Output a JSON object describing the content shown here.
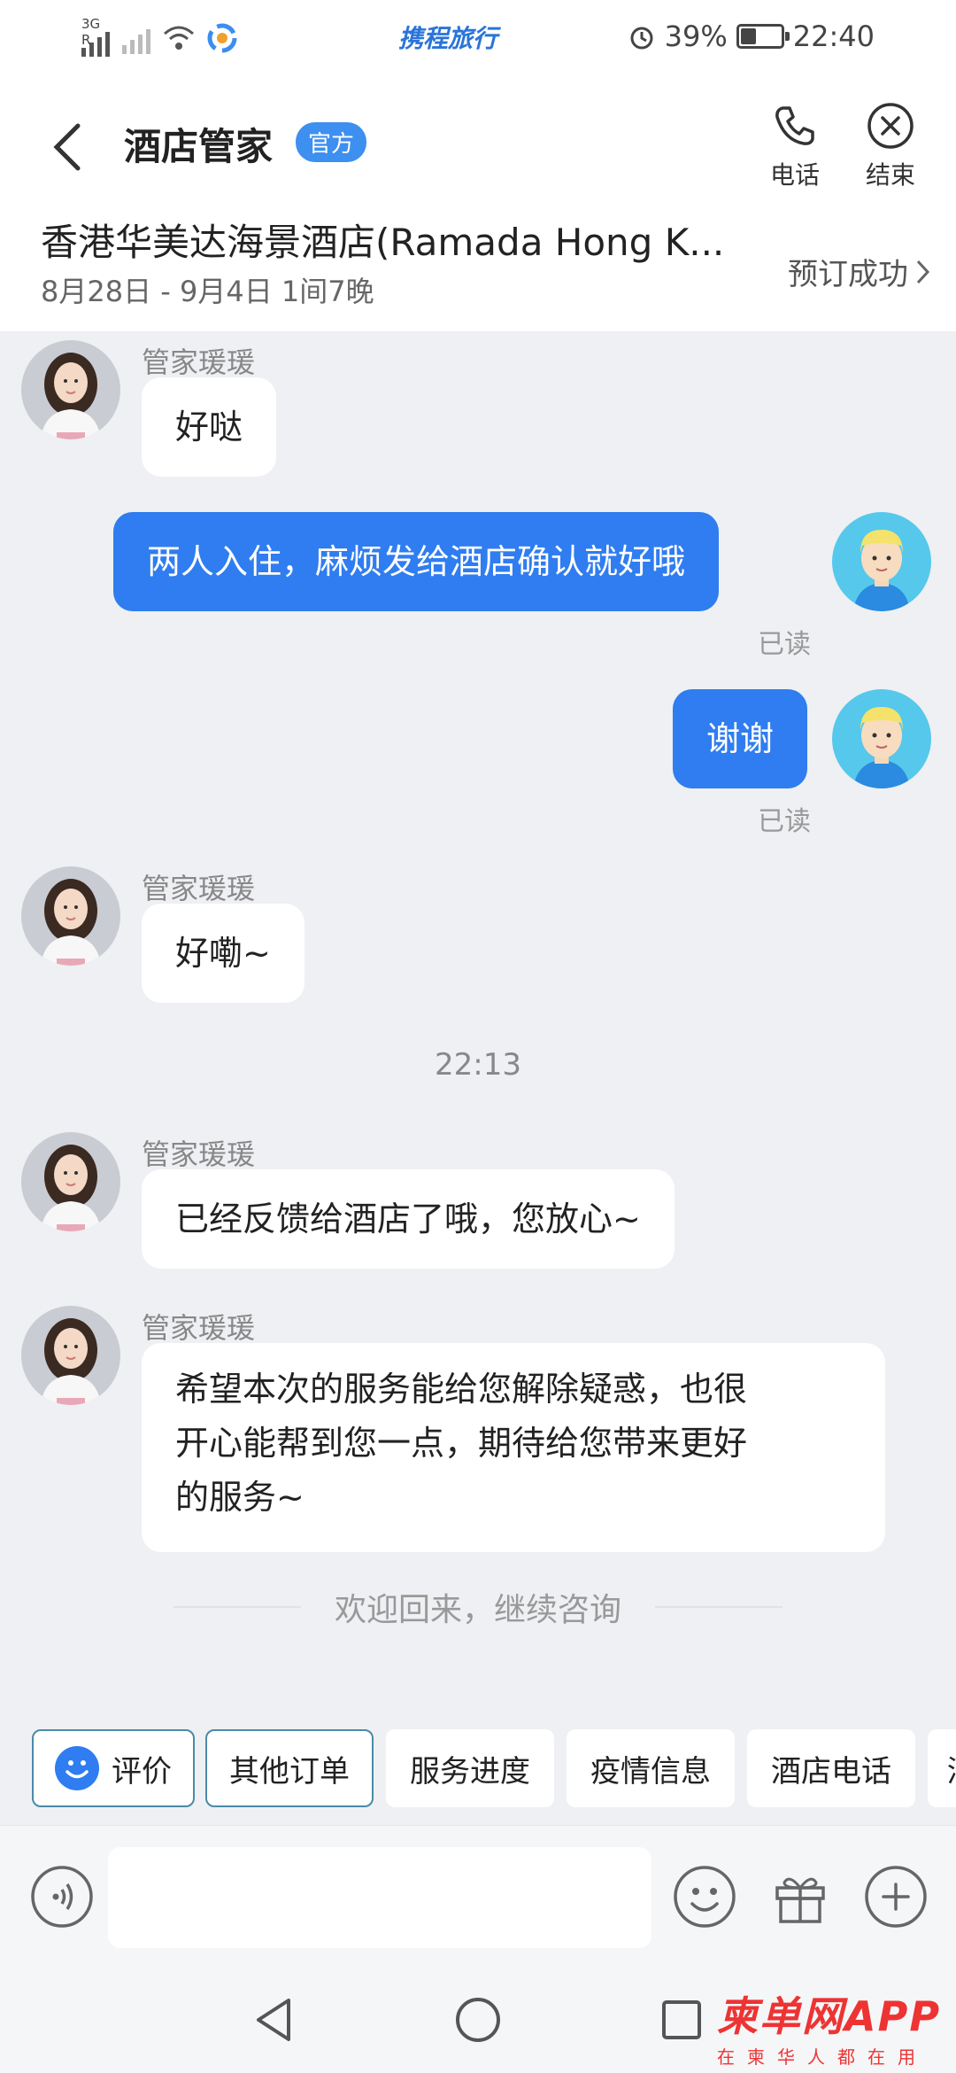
{
  "status_bar": {
    "network_label": "3G R",
    "app_title": "携程旅行",
    "battery": "39%",
    "battery_level": 0.39,
    "time": "22:40"
  },
  "header": {
    "title": "酒店管家",
    "badge": "官方",
    "phone_label": "电话",
    "end_label": "结束",
    "hotel_name": "香港华美达海景酒店(Ramada Hong K...",
    "dates": "8月28日 - 9月4日 1间7晚",
    "status": "预订成功"
  },
  "messages": [
    {
      "sender": "管家瑗瑗",
      "text": "好哒"
    },
    {
      "text": "两人入住，麻烦发给酒店确认就好哦",
      "read": "已读"
    },
    {
      "text": "谢谢",
      "read": "已读"
    },
    {
      "sender": "管家瑗瑗",
      "text": "好嘞~"
    },
    {
      "timestamp": "22:13"
    },
    {
      "sender": "管家瑗瑗",
      "text": "已经反馈给酒店了哦，您放心~"
    },
    {
      "sender": "管家瑗瑗",
      "lines": [
        "希望本次的服务能给您解除疑惑，也很",
        "开心能帮到您一点，期待给您带来更好",
        "的服务~"
      ]
    }
  ],
  "system_notice": "欢迎回来，继续咨询",
  "quick_actions": [
    "评价",
    "其他订单",
    "服务进度",
    "疫情信息",
    "酒店电话",
    "酒"
  ],
  "input": {
    "value": "",
    "placeholder": ""
  },
  "watermark": {
    "logo": "柬单网APP",
    "tagline": "在柬华人都在用"
  },
  "colors": {
    "accent": "#2f7df0",
    "badge": "#3d8ff0",
    "watermark": "#e33"
  },
  "icons": [
    "back-arrow-icon",
    "phone-icon",
    "close-circle-icon",
    "chevron-right-icon",
    "voice-icon",
    "emoji-icon",
    "gift-icon",
    "plus-circle-icon"
  ]
}
